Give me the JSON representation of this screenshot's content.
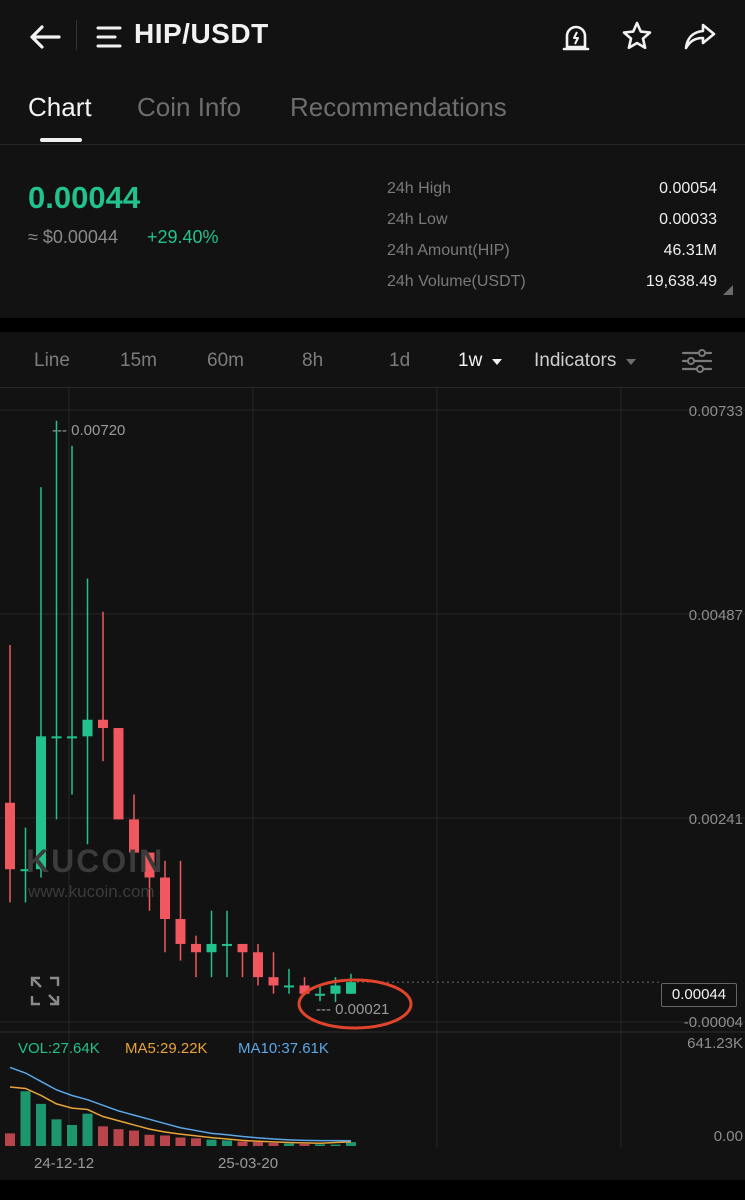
{
  "header": {
    "title": "HIP/USDT",
    "icons": [
      "back-arrow-icon",
      "menu-lines-icon",
      "alert-bell-icon",
      "star-icon",
      "share-icon"
    ]
  },
  "tabs": [
    {
      "label": "Chart",
      "active": true
    },
    {
      "label": "Coin Info",
      "active": false
    },
    {
      "label": "Recommendations",
      "active": false
    }
  ],
  "ticker": {
    "last_price": "0.00044",
    "fiat_price": "≈ $0.00044",
    "change_pct": "+29.40%",
    "up_color": "#21c28e",
    "down_color": "#f0575f"
  },
  "stats": [
    {
      "label": "24h High",
      "value": "0.00054"
    },
    {
      "label": "24h Low",
      "value": "0.00033"
    },
    {
      "label": "24h Amount(HIP)",
      "value": "46.31M"
    },
    {
      "label": "24h Volume(USDT)",
      "value": "19,638.49"
    }
  ],
  "toolbar": {
    "items": [
      "Line",
      "15m",
      "60m",
      "8h",
      "1d"
    ],
    "interval": "1w",
    "indicators": "Indicators",
    "settings_icon": "sliders-icon"
  },
  "chart": {
    "watermark": "KUCOIN",
    "watermark_url": "www.kucoin.com",
    "y_ticks": [
      "0.00733",
      "0.00487",
      "0.00241",
      "-0.00004"
    ],
    "high_marker": "0.00720",
    "low_marker": "0.00021",
    "current_price": "0.00044",
    "vol_axis_max": "641.23K",
    "vol_axis_min": "0.00",
    "indicators": {
      "vol": "VOL:27.64K",
      "ma5": "MA5:29.22K",
      "ma10": "MA10:37.61K",
      "ma5_color": "#e8a33a",
      "ma10_color": "#5ba7e8"
    },
    "dates": [
      "24-12-12",
      "25-03-20"
    ]
  },
  "chart_data": {
    "type": "candlestick",
    "interval": "1w",
    "candles": [
      {
        "o": 0.0026,
        "h": 0.0045,
        "l": 0.0014,
        "c": 0.0018
      },
      {
        "o": 0.0018,
        "h": 0.0023,
        "l": 0.0014,
        "c": 0.0018
      },
      {
        "o": 0.0018,
        "h": 0.0064,
        "l": 0.0017,
        "c": 0.0034
      },
      {
        "o": 0.0034,
        "h": 0.0072,
        "l": 0.0024,
        "c": 0.0034
      },
      {
        "o": 0.0034,
        "h": 0.0069,
        "l": 0.0027,
        "c": 0.0034
      },
      {
        "o": 0.0034,
        "h": 0.0053,
        "l": 0.0021,
        "c": 0.0036
      },
      {
        "o": 0.0036,
        "h": 0.0049,
        "l": 0.0031,
        "c": 0.0035
      },
      {
        "o": 0.0035,
        "h": 0.0035,
        "l": 0.0024,
        "c": 0.0024
      },
      {
        "o": 0.0024,
        "h": 0.0027,
        "l": 0.002,
        "c": 0.002
      },
      {
        "o": 0.002,
        "h": 0.002,
        "l": 0.0013,
        "c": 0.0017
      },
      {
        "o": 0.0017,
        "h": 0.0019,
        "l": 0.0008,
        "c": 0.0012
      },
      {
        "o": 0.0012,
        "h": 0.0019,
        "l": 0.0007,
        "c": 0.0009
      },
      {
        "o": 0.0009,
        "h": 0.001,
        "l": 0.0005,
        "c": 0.0008
      },
      {
        "o": 0.0008,
        "h": 0.0013,
        "l": 0.0005,
        "c": 0.0009
      },
      {
        "o": 0.0009,
        "h": 0.0013,
        "l": 0.0005,
        "c": 0.0009
      },
      {
        "o": 0.0009,
        "h": 0.0009,
        "l": 0.0005,
        "c": 0.0008
      },
      {
        "o": 0.0008,
        "h": 0.0009,
        "l": 0.0004,
        "c": 0.0005
      },
      {
        "o": 0.0005,
        "h": 0.0008,
        "l": 0.0003,
        "c": 0.0004
      },
      {
        "o": 0.0004,
        "h": 0.0006,
        "l": 0.0003,
        "c": 0.0004
      },
      {
        "o": 0.0004,
        "h": 0.0005,
        "l": 0.0003,
        "c": 0.0003
      },
      {
        "o": 0.0003,
        "h": 0.0004,
        "l": 0.00021,
        "c": 0.0003
      },
      {
        "o": 0.0003,
        "h": 0.0005,
        "l": 0.0002,
        "c": 0.0004
      },
      {
        "o": 0.0003,
        "h": 0.00054,
        "l": 0.0003,
        "c": 0.00044
      }
    ],
    "volume": [
      90,
      390,
      300,
      190,
      150,
      230,
      140,
      120,
      110,
      80,
      75,
      60,
      55,
      45,
      40,
      32,
      28,
      22,
      18,
      15,
      12,
      10,
      27.64
    ],
    "ma5": [
      420,
      410,
      360,
      300,
      270,
      260,
      210,
      180,
      150,
      120,
      100,
      85,
      72,
      60,
      50,
      40,
      34,
      29,
      25,
      22,
      20,
      25,
      29.22
    ],
    "ma10": [
      560,
      520,
      460,
      400,
      360,
      330,
      290,
      250,
      220,
      190,
      160,
      130,
      110,
      90,
      80,
      68,
      58,
      50,
      44,
      40,
      38,
      38,
      37.61
    ],
    "ylim": [
      -4e-05,
      0.00733
    ],
    "vol_ylim": [
      0,
      641.23
    ]
  }
}
